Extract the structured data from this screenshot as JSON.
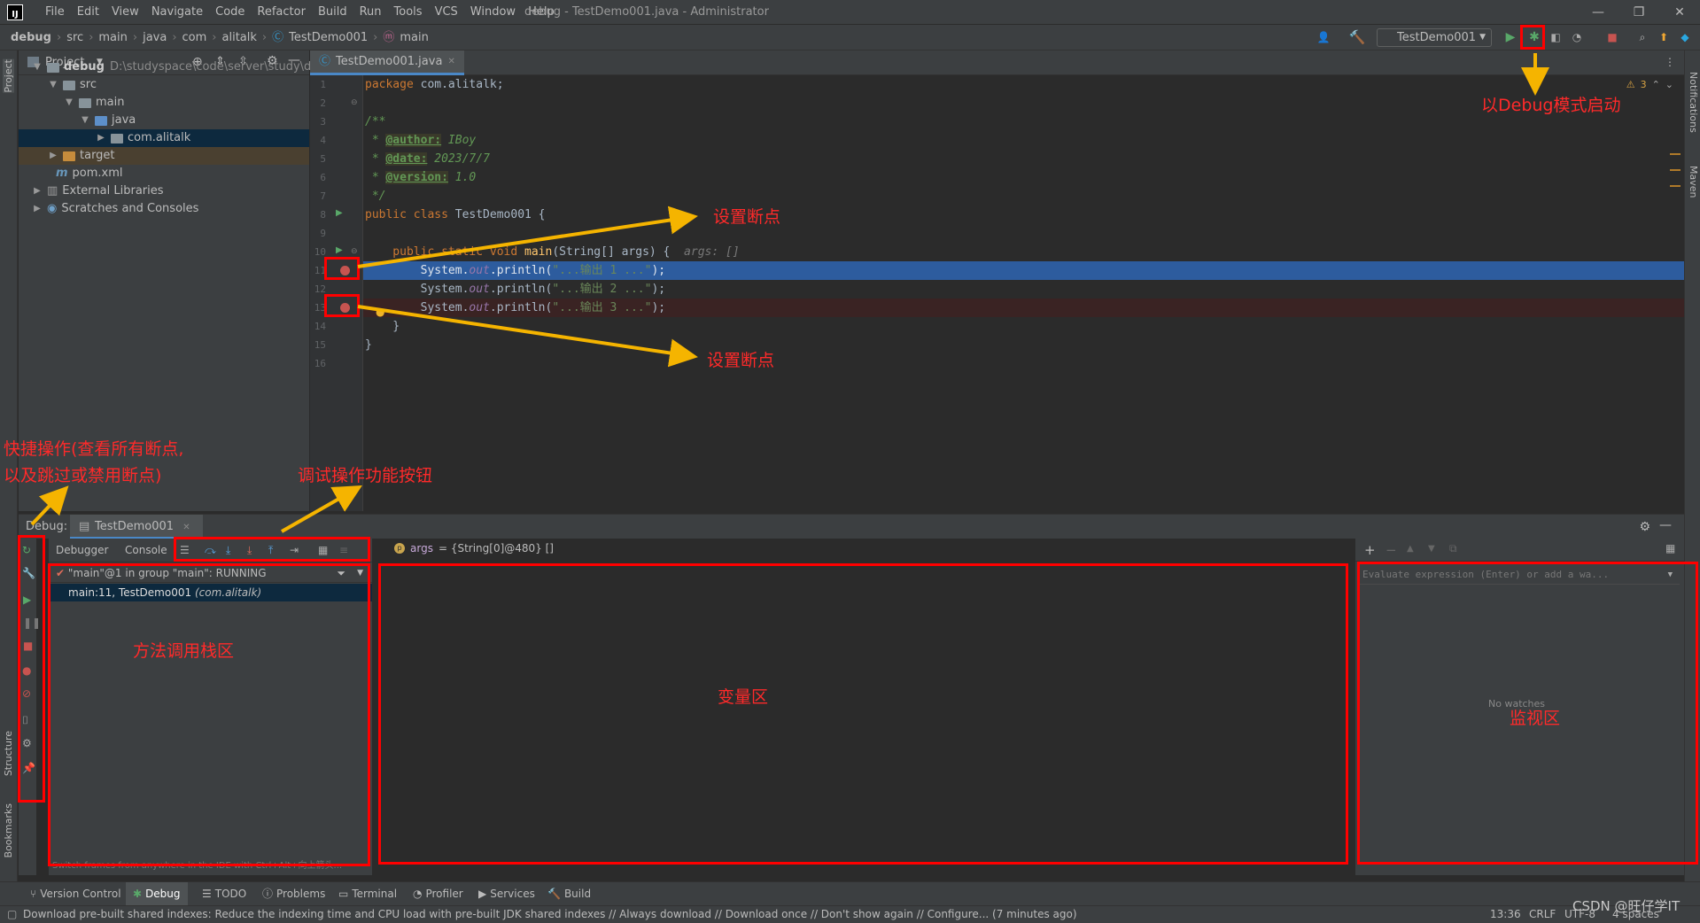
{
  "menubar": {
    "logo": "IJ",
    "items": [
      "File",
      "Edit",
      "View",
      "Navigate",
      "Code",
      "Refactor",
      "Build",
      "Run",
      "Tools",
      "VCS",
      "Window",
      "Help"
    ],
    "title": "debug - TestDemo001.java - Administrator"
  },
  "navbar": {
    "crumbs": [
      "debug",
      "src",
      "main",
      "java",
      "com",
      "alitalk",
      "TestDemo001",
      "main"
    ],
    "run_config": "TestDemo001"
  },
  "project": {
    "header": "Project",
    "root_name": "debug",
    "root_path": "D:\\studyspace\\code\\server\\study\\debug",
    "src": "src",
    "main": "main",
    "java": "java",
    "package": "com.alitalk",
    "target": "target",
    "pom": "pom.xml",
    "ext_libs": "External Libraries",
    "scratches": "Scratches and Consoles"
  },
  "left_strip": {
    "project": "Project",
    "structure": "Structure",
    "bookmarks": "Bookmarks"
  },
  "right_strip": {
    "notifications": "Notifications",
    "maven": "Maven"
  },
  "editor": {
    "tab": "TestDemo001.java",
    "warnings": "3",
    "line_numbers": [
      "1",
      "2",
      "3",
      "4",
      "5",
      "6",
      "7",
      "8",
      "9",
      "10",
      "11",
      "12",
      "13",
      "14",
      "15",
      "16"
    ],
    "l1_kw": "package",
    "l1_rest": " com.alitalk;",
    "l3": "/**",
    "l4_pre": " * ",
    "l4_tag": "@author:",
    "l4_val": " IBoy",
    "l5_pre": " * ",
    "l5_tag": "@date:",
    "l5_val": " 2023/7/7",
    "l6_pre": " * ",
    "l6_tag": "@version:",
    "l6_val": " 1.0",
    "l7": " */",
    "l8_kw": "public class",
    "l8_rest": " TestDemo001 {",
    "l10_kw": "    public static void ",
    "l10_fn": "main",
    "l10_rest": "(String[] args) {",
    "l10_hint": "  args: []",
    "l11_a": "        System.",
    "l11_b": "out",
    "l11_c": ".println(",
    "l11_s": "\"...输出 1 ...\"",
    "l11_d": ");",
    "l12_a": "        System.",
    "l12_b": "out",
    "l12_c": ".println(",
    "l12_s": "\"...输出 2 ...\"",
    "l12_d": ");",
    "l13_a": "        System.",
    "l13_b": "out",
    "l13_c": ".println(",
    "l13_s": "\"...输出 3 ...\"",
    "l13_d": ");",
    "l14": "    }",
    "l15": "}"
  },
  "debug": {
    "label": "Debug:",
    "session_tab": "TestDemo001",
    "sub_debugger": "Debugger",
    "sub_console": "Console",
    "thread": "\"main\"@1 in group \"main\": RUNNING",
    "frame_main": "main:11, TestDemo001",
    "frame_pkg": "(com.alitalk)",
    "var_name": "args",
    "var_value": "= {String[0]@480} []",
    "eval_placeholder": "Evaluate expression (Enter) or add a wa...",
    "no_watches": "No watches",
    "switch_hint": "Switch frames from anywhere in the IDE with Ctrl+Alt+向上箭头..."
  },
  "bottombar": {
    "items": [
      "Version Control",
      "Debug",
      "TODO",
      "Problems",
      "Terminal",
      "Profiler",
      "Services",
      "Build"
    ]
  },
  "statusbar": {
    "message": "Download pre-built shared indexes: Reduce the indexing time and CPU load with pre-built JDK shared indexes // Always download // Download once // Don't show again // Configure... (7 minutes ago)",
    "time": "13:36",
    "crlf": "CRLF",
    "encoding": "UTF-8",
    "indent": "4 spaces"
  },
  "annotations": {
    "debug_start": "以Debug模式启动",
    "breakpoint1": "设置断点",
    "breakpoint2": "设置断点",
    "quick_ops": "快捷操作(查看所有断点,\n以及跳过或禁用断点)",
    "debug_buttons": "调试操作功能按钮",
    "frames_area": "方法调用栈区",
    "vars_area": "变量区",
    "watch_area": "监视区",
    "watermark": "CSDN @旺仔学IT"
  },
  "colors": {
    "exec_line": "#2d5c9e",
    "breakpoint_line": "#3a2323",
    "breakpoint": "#c75450",
    "annotation": "#ff2a2a",
    "arrow": "#f5b400"
  }
}
